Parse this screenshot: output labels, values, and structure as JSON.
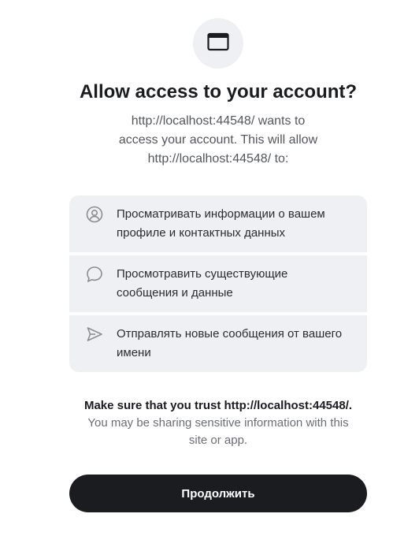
{
  "dialog": {
    "app_icon": "browser-window-icon",
    "title": "Allow access to your account?",
    "subtitle": "http://localhost:44548/ wants to access your account. This will allow http://localhost:44548/ to:"
  },
  "permissions": [
    {
      "icon": "user-profile-icon",
      "text": "Просматривать информации о вашем профиле и контактных данных"
    },
    {
      "icon": "chat-bubble-icon",
      "text": "Просмотравить существующие сообщения и данные"
    },
    {
      "icon": "send-icon",
      "text": "Отправлять новые сообщения от вашего имени"
    }
  ],
  "trust": {
    "title": "Make sure that you trust http://localhost:44548/.",
    "description": "You may be sharing sensitive information with this site or app."
  },
  "actions": {
    "continue_label": "Продолжить"
  },
  "colors": {
    "background": "#ffffff",
    "panel": "#eef0f3",
    "primary_button": "#1b1c20",
    "text_primary": "#1b1c20",
    "text_secondary": "#53565c",
    "icon": "#8a8d93"
  }
}
